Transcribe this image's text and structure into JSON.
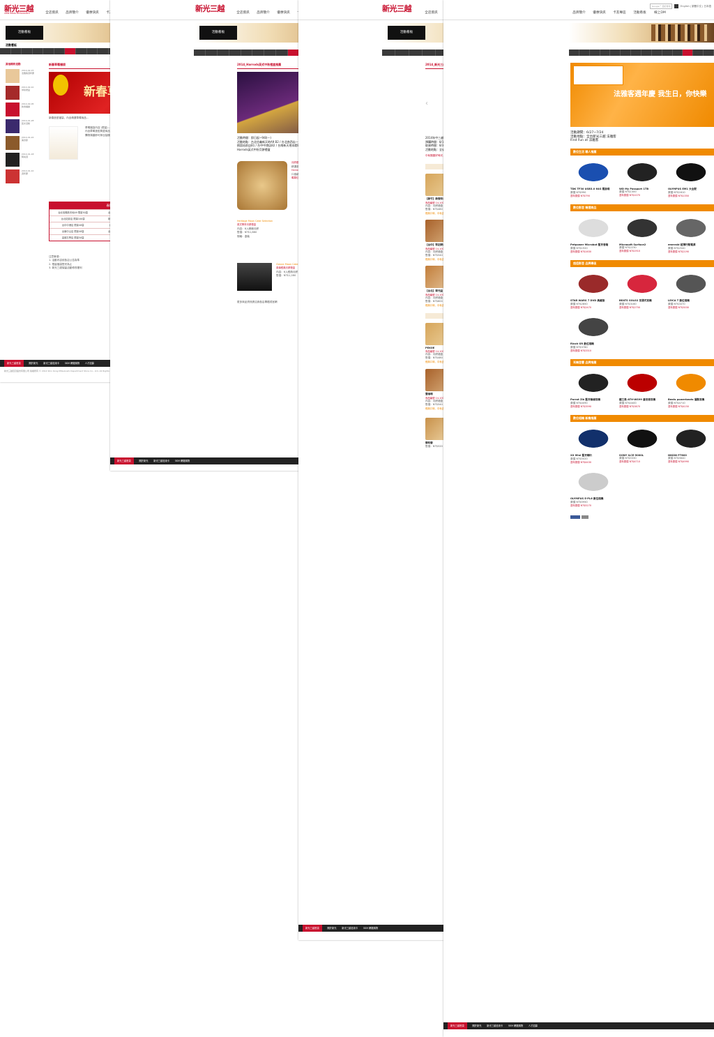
{
  "brand": {
    "logo": "新光三越",
    "logo_sub": "SHIN KONG MITSUKOSHI"
  },
  "nav": [
    "全店資訊",
    "品牌簡介",
    "優惠快訊",
    "卡友專區",
    "活動看板",
    "線上DM"
  ],
  "util": {
    "search_placeholder": "Google™ 自訂搜尋",
    "lang": "English | 繁體中文 | 日本語"
  },
  "banner_button": "活動看板",
  "section_title": "活動看板",
  "sidebar_title": "其他精彩活動",
  "page1": {
    "section": "新春草莓福袋",
    "banner_text": "新春草莓福袋",
    "table_title": "春節福袋(含)專櫃(DM)",
    "table_rows": [
      [
        "台北信義新天地A9 限量50袋",
        "台北南西店 限量100袋",
        "台北天母店 限量50袋"
      ],
      [
        "台北站前店 限量100袋",
        "桃園站前店 限量100袋",
        "新竹中華店 限量40袋"
      ],
      [
        "台中中港店 限量40袋",
        "台中三越 限量100袋",
        "嘉義垂楊店 限量40袋"
      ],
      [
        "台南中山店 限量40袋",
        "台南新天地 限量100袋",
        "高雄三多店 限量40袋"
      ],
      [
        "高雄左營店 限量50袋",
        "",
        ""
      ]
    ]
  },
  "page2": {
    "section": "2014_Harrods英式中秋禮盒推薦",
    "info_lines": [
      "活動時間：即日起~9/8(一)",
      "活動地點：台北信義新天地A9 B2 / 台北南西店一館B1 / 台北天母店A館B1 /",
      "桃園站前店B1 / 台中中港店B2 / 台南新天地本館B1 / 台南中山店B1 / 高雄左營店本館B1"
    ],
    "brand": "Harrods英式中秋月餅禮盒",
    "items": [
      "Heritage Moon Cake Selection",
      "英式尊享月餅禮盒",
      "Classic Moon Cake Selection",
      "英倫經典月餅禮盒"
    ],
    "more": "更多商品資訊請洽詢各店專櫃或官網"
  },
  "page3": {
    "section": "2014_新光三越中秋禮盒推薦~中秋佳節團聚好時光",
    "info": [
      "2014年中三越中秋禮盒",
      "預購時間：8/1(五)~8/3(日)",
      "取貨時間：8/31(日)~9/8(一)",
      "活動地點：全省新光三越館別"
    ],
    "cat1": "傳統糕點・台灣精選",
    "cat2": "伴手禮盒・精品珍饌",
    "products_row1": [
      "【新竹】新復珍商行",
      "【台中】林金生香",
      "【台中】太陽堂老店"
    ],
    "products_row2": [
      "【台中】犁記餅店",
      "【彰化】鹿港玉珍齋",
      "【台北】順成蛋糕"
    ],
    "products_row3": [
      "【台北】郭元益",
      "【台北】犁記",
      "【台北】大黑松小倆口"
    ],
    "products_row4": [
      "PEKOE",
      "好丘",
      "咖啡碼頭"
    ],
    "products_row5": [
      "壹咖啡",
      "品憶軒",
      "心齊羅星港"
    ],
    "products_row6": [
      "御珍齋",
      "紅豆食府",
      "台中李製",
      "糖果九九"
    ]
  },
  "page4": {
    "section": "活動看板",
    "banner_title": "法雅客週年慶 我生日，你快樂",
    "dates": "活動期間：6/27~7/24",
    "place": "活動地點：全台新光三越 法雅客",
    "tagline": "Find Fun at 法雅客",
    "cats": [
      "數位生活 職人推薦",
      "數位影音 精選商品",
      "超值影音 品牌專區",
      "耳機音響 品牌推薦",
      "數位相機 新機推薦"
    ],
    "products": [
      "TDK TF30 USB3.0 64G 隨身碟",
      "WD My Passport 1TB",
      "OLYMPUS EM1 大全配",
      "Petpower Microbot 藍牙音箱",
      "Microsoft Surface2",
      "emerald 超薄行動電源",
      "STAR WARS 7 DVD 典藏版",
      "BEATS SOLO2 耳罩式耳機",
      "LEICA T 數位相機",
      "Ricoh GR 數位相機",
      "Parrot Zik 藍牙無線耳機",
      "鐵三角 ATH-WS99 重低音耳機",
      "Beats powerbeats 運動耳機",
      "XX Mini 藍牙喇叭",
      "SONY ILCE-5000L",
      "NIKON P7800",
      "OLYMPUS E-PL6 數位相機",
      "OLYMPUS XZ-2 數位相機"
    ]
  },
  "footer": [
    "新光三越首頁",
    "關於新光",
    "新光三越信用卡",
    "SKM 網路購物",
    "人才招募",
    "聯絡我們",
    "Privacy",
    "Admin"
  ],
  "copyright": "新光三越百貨股份有限公司 版權所有 © 2014 Shin Kong Mitsukoshi Department Store Co., Ltd. All Rights Reserved.",
  "colors": {
    "brand_red": "#c8102e",
    "accent_orange": "#f08a00",
    "dark_bar": "#3a3a3a"
  }
}
